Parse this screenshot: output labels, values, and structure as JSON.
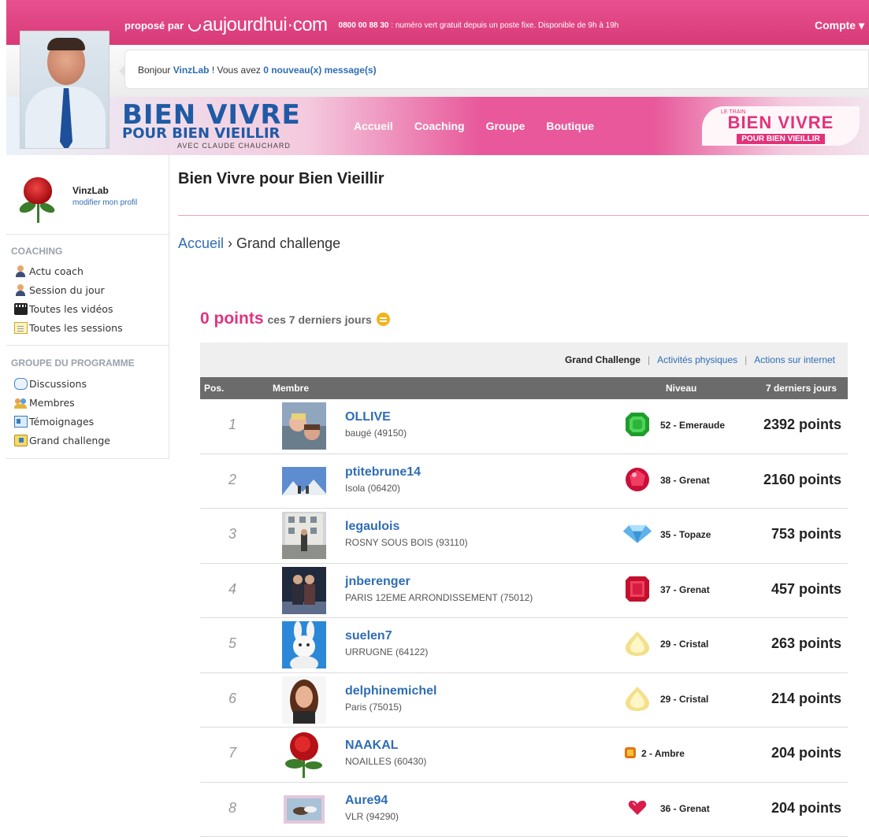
{
  "topbar": {
    "proposed_by": "proposé par",
    "brand": "aujourdhui·com",
    "phone_number": "0800 00 88 30",
    "phone_text": " : numéro vert gratuit depuis un poste fixe. Disponible de 9h à 19h",
    "account": "Compte ▾"
  },
  "greeting": {
    "hello": "Bonjour ",
    "user": "VinzLab",
    "middle": " ! Vous avez ",
    "messages": "0 nouveau(x) message(s)"
  },
  "banner": {
    "title_line1": "BIEN VIVRE",
    "title_line2": "POUR BIEN VIEILLIR",
    "title_line3": "AVEC CLAUDE CHAUCHARD",
    "nav": [
      "Accueil",
      "Coaching",
      "Groupe",
      "Boutique"
    ],
    "right_logo_small": "LE TRAIN",
    "right_logo_big": "BIEN VIVRE",
    "right_logo_sub": "POUR BIEN VIEILLIR"
  },
  "sidebar": {
    "profile_name": "VinzLab",
    "profile_edit": "modifier mon profil",
    "coaching_heading": "COACHING",
    "coaching_items": [
      "Actu coach",
      "Session du jour",
      "Toutes les vidéos",
      "Toutes les sessions"
    ],
    "group_heading": "GROUPE DU PROGRAMME",
    "group_items": [
      "Discussions",
      "Membres",
      "Témoignages",
      "Grand challenge"
    ]
  },
  "main": {
    "title": "Bien Vivre pour Bien Vieillir",
    "breadcrumb_home": "Accueil",
    "breadcrumb_sep": " › ",
    "breadcrumb_current": "Grand challenge",
    "points_value": "0 points",
    "points_period": "ces 7 derniers jours"
  },
  "filters": {
    "active": "Grand Challenge",
    "links": [
      "Activités physiques",
      "Actions sur internet"
    ],
    "separator": "|"
  },
  "table": {
    "headers": {
      "pos": "Pos.",
      "member": "Membre",
      "level": "Niveau",
      "period": "7 derniers jours"
    },
    "rows": [
      {
        "pos": "1",
        "name": "OLLIVE",
        "location": "baugé (49150)",
        "level": "52 - Emeraude",
        "gem": "emerald-gem-icon",
        "score": "2392 points"
      },
      {
        "pos": "2",
        "name": "ptitebrune14",
        "location": "Isola (06420)",
        "level": "38 - Grenat",
        "gem": "garnet-round-gem-icon",
        "score": "2160 points"
      },
      {
        "pos": "3",
        "name": "legaulois",
        "location": "ROSNY SOUS BOIS (93110)",
        "level": "35 - Topaze",
        "gem": "topaz-gem-icon",
        "score": "753 points"
      },
      {
        "pos": "4",
        "name": "jnberenger",
        "location": "PARIS 12EME ARRONDISSEMENT (75012)",
        "level": "37 - Grenat",
        "gem": "garnet-square-gem-icon",
        "score": "457 points"
      },
      {
        "pos": "5",
        "name": "suelen7",
        "location": "URRUGNE (64122)",
        "level": "29 - Cristal",
        "gem": "crystal-gem-icon",
        "score": "263 points"
      },
      {
        "pos": "6",
        "name": "delphinemichel",
        "location": "Paris (75015)",
        "level": "29 - Cristal",
        "gem": "crystal-gem-icon",
        "score": "214 points"
      },
      {
        "pos": "7",
        "name": "NAAKAL",
        "location": "NOAILLES (60430)",
        "level": "2 - Ambre",
        "gem": "amber-gem-icon",
        "score": "204 points"
      },
      {
        "pos": "8",
        "name": "Aure94",
        "location": "VLR (94290)",
        "level": "36 - Grenat",
        "gem": "garnet-heart-gem-icon",
        "score": "204 points"
      }
    ]
  },
  "colors": {
    "brand_pink": "#e0337e",
    "link_blue": "#2f6db4",
    "header_gray": "#6b6b6b"
  }
}
